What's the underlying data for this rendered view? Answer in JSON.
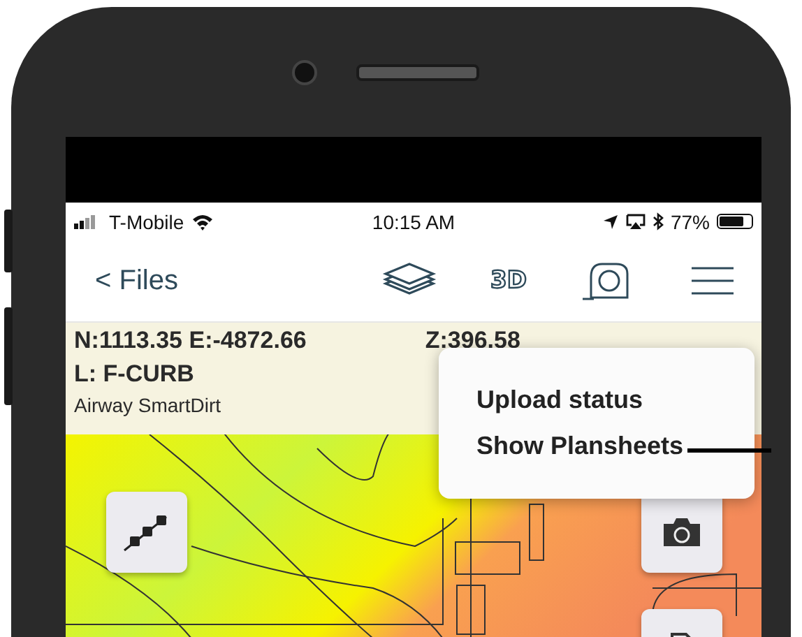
{
  "status_bar": {
    "carrier": "T-Mobile",
    "time": "10:15 AM",
    "battery": "77%"
  },
  "nav_bar": {
    "back": "< Files",
    "mode_button": "3D"
  },
  "info_panel": {
    "coordinates": "N:1113.35 E:-4872.66",
    "layer": "L: F-CURB",
    "project": "Airway SmartDirt",
    "elevation": "Z:396.58"
  },
  "menu": {
    "items": [
      {
        "label": "Upload status"
      },
      {
        "label": "Show Plansheets"
      }
    ]
  }
}
